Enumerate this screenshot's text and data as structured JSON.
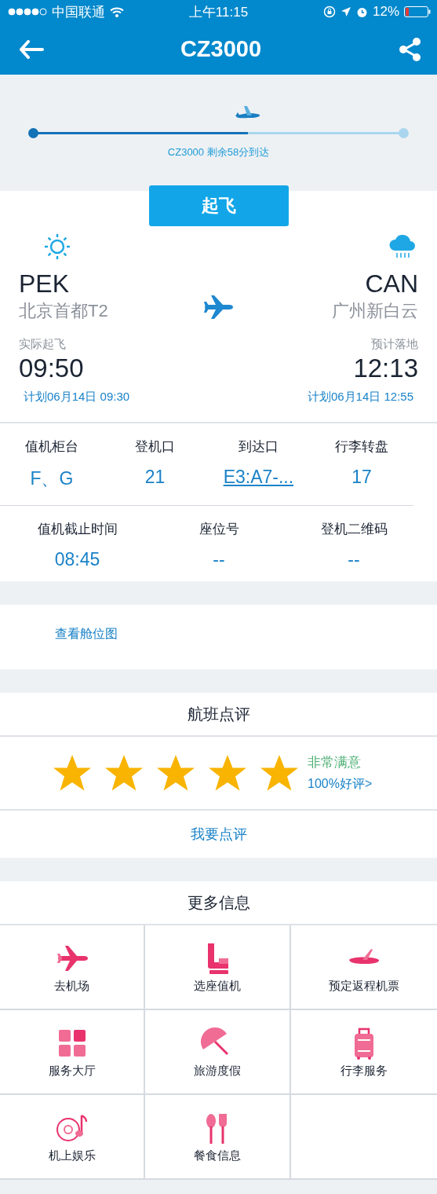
{
  "status_bar": {
    "carrier": "中国联通",
    "time": "上午11:15",
    "battery": "12%"
  },
  "nav": {
    "title": "CZ3000"
  },
  "progress": {
    "level": 0.58,
    "caption": "CZ3000 剩余58分到达"
  },
  "status_button": "起飞",
  "departure": {
    "code": "PEK",
    "airport": "北京首都T2",
    "time_label": "实际起飞",
    "time": "09:50",
    "scheduled": "计划06月14日 09:30"
  },
  "arrival": {
    "code": "CAN",
    "airport": "广州新白云",
    "time_label": "预计落地",
    "time": "12:13",
    "scheduled": "计划06月14日 12:55"
  },
  "info_row_1": [
    {
      "label": "值机柜台",
      "value": "F、G",
      "link": false
    },
    {
      "label": "登机口",
      "value": "21",
      "link": false
    },
    {
      "label": "到达口",
      "value": "E3:A7-...",
      "link": true
    },
    {
      "label": "行李转盘",
      "value": "17",
      "link": false
    }
  ],
  "info_row_2": [
    {
      "label": "值机截止时间",
      "value": "08:45",
      "link": false
    },
    {
      "label": "座位号",
      "value": "--",
      "link": false
    },
    {
      "label": "登机二维码",
      "value": "--",
      "link": false
    }
  ],
  "seat_map_link": "查看舱位图",
  "review": {
    "title": "航班点评",
    "stars": 5,
    "rating": "非常满意",
    "summary": "100%好评>",
    "action": "我要点评"
  },
  "more": {
    "title": "更多信息",
    "items": [
      {
        "label": "去机场"
      },
      {
        "label": "选座值机"
      },
      {
        "label": "预定返程机票"
      },
      {
        "label": "服务大厅"
      },
      {
        "label": "旅游度假"
      },
      {
        "label": "行李服务"
      },
      {
        "label": "机上娱乐"
      },
      {
        "label": "餐食信息"
      }
    ]
  }
}
